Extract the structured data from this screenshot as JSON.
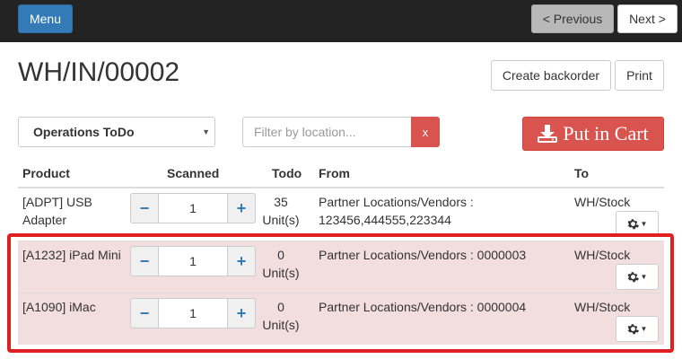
{
  "topbar": {
    "menu_label": "Menu",
    "previous_label": "< Previous",
    "next_label": "Next >"
  },
  "page": {
    "title": "WH/IN/00002",
    "create_backorder_label": "Create backorder",
    "print_label": "Print"
  },
  "toolbar": {
    "operations_select": "Operations ToDo",
    "filter_placeholder": "Filter by location...",
    "filter_clear": "x",
    "put_in_cart_label": "Put in Cart"
  },
  "table": {
    "headers": {
      "product": "Product",
      "scanned": "Scanned",
      "todo": "Todo",
      "from": "From",
      "to": "To"
    },
    "rows": [
      {
        "product": "[ADPT] USB Adapter",
        "scanned": "1",
        "todo": "35 Unit(s)",
        "from": "Partner Locations/Vendors : 123456,444555,223344",
        "to": "WH/Stock"
      },
      {
        "product": "[A1232] iPad Mini",
        "scanned": "1",
        "todo": "0 Unit(s)",
        "from": "Partner Locations/Vendors : 0000003",
        "to": "WH/Stock"
      },
      {
        "product": "[A1090] iMac",
        "scanned": "1",
        "todo": "0 Unit(s)",
        "from": "Partner Locations/Vendors : 0000004",
        "to": "WH/Stock"
      }
    ],
    "stepper_minus": "−",
    "stepper_plus": "+"
  },
  "colors": {
    "topbar_bg": "#232323",
    "primary": "#337ab7",
    "danger": "#d9534f",
    "highlight_row": "#f2dede",
    "annotation_border": "#e02020"
  },
  "icons": {
    "put_in_cart": "download-icon",
    "row_action": "gear-icon"
  }
}
